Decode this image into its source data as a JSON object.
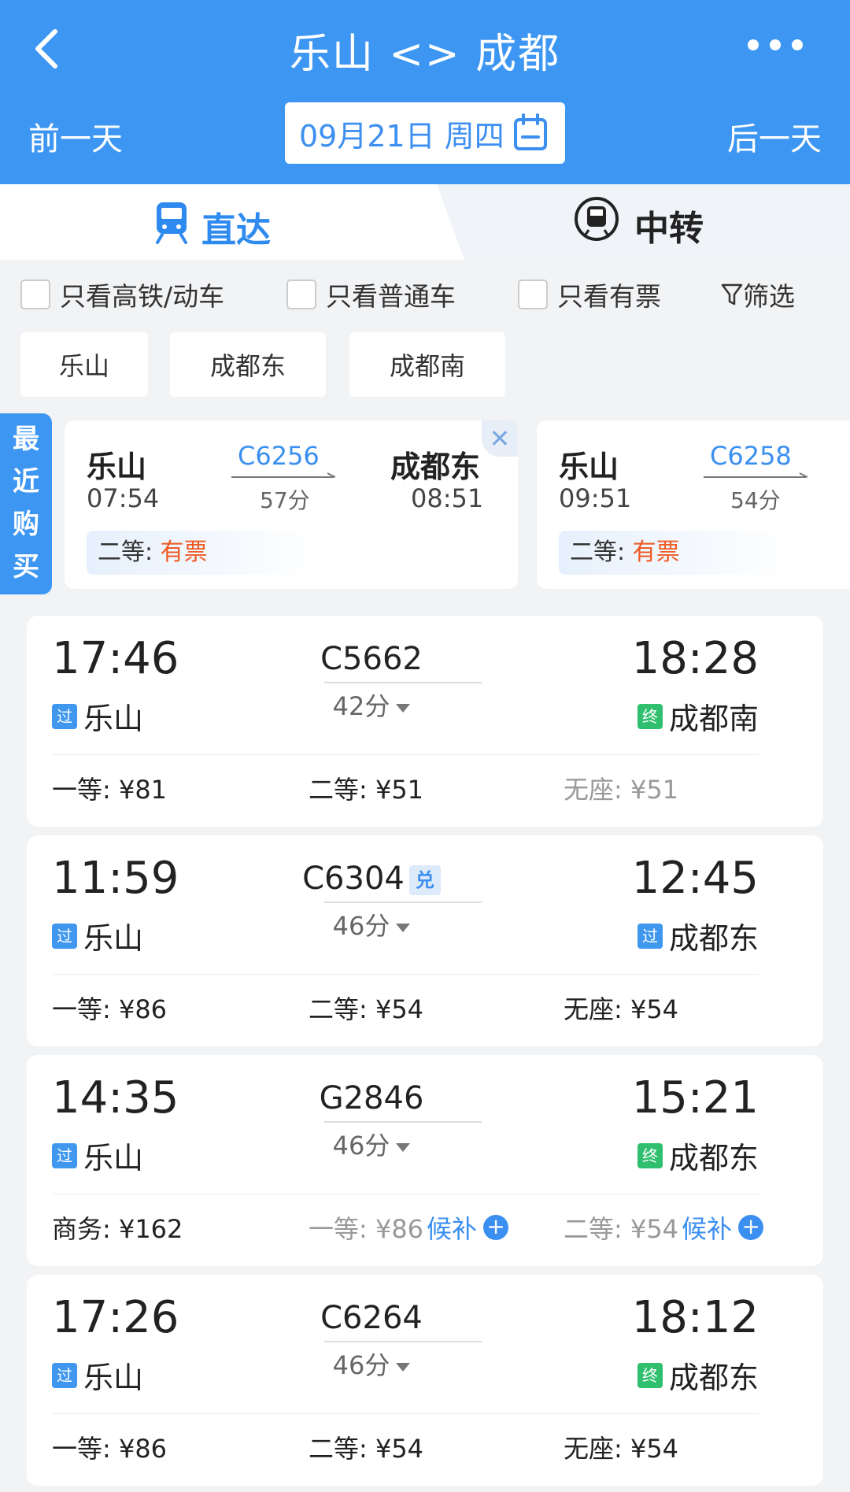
{
  "header": {
    "title": "乐山 <> 成都",
    "prev_day": "前一天",
    "next_day": "后一天",
    "date": "09月21日 周四"
  },
  "tabs": [
    {
      "label": "直达",
      "icon": "train-icon",
      "active": true
    },
    {
      "label": "中转",
      "icon": "transfer-train-icon",
      "active": false
    }
  ],
  "filters": {
    "checkboxes": [
      "只看高铁/动车",
      "只看普通车",
      "只看有票"
    ],
    "filter_label": "筛选",
    "stations": [
      "乐山",
      "成都东",
      "成都南"
    ]
  },
  "recent": {
    "tag": "最近购买",
    "cards": [
      {
        "from": "乐山",
        "dep": "07:54",
        "train": "C6256",
        "duration": "57分",
        "to": "成都东",
        "arr": "08:51",
        "seat": "二等:",
        "status": "有票"
      },
      {
        "from": "乐山",
        "dep": "09:51",
        "train": "C6258",
        "duration": "54分",
        "seat": "二等:",
        "status": "有票"
      }
    ]
  },
  "trains": [
    {
      "dep": "17:46",
      "from": "乐山",
      "from_badge": "过",
      "train": "C5662",
      "duration": "42分",
      "arr": "18:28",
      "to": "成都南",
      "to_badge": "终",
      "prices": [
        {
          "text": "一等: ¥81",
          "gray": false
        },
        {
          "text": "二等: ¥51",
          "gray": false
        },
        {
          "text": "无座: ¥51",
          "gray": true
        }
      ]
    },
    {
      "dep": "11:59",
      "from": "乐山",
      "from_badge": "过",
      "train": "C6304",
      "tag": "兑",
      "duration": "46分",
      "arr": "12:45",
      "to": "成都东",
      "to_badge": "过",
      "prices": [
        {
          "text": "一等: ¥86",
          "gray": false
        },
        {
          "text": "二等: ¥54",
          "gray": false
        },
        {
          "text": "无座: ¥54",
          "gray": false
        }
      ]
    },
    {
      "dep": "14:35",
      "from": "乐山",
      "from_badge": "过",
      "train": "G2846",
      "duration": "46分",
      "arr": "15:21",
      "to": "成都东",
      "to_badge": "终",
      "prices": [
        {
          "text": "商务: ¥162",
          "gray": false
        },
        {
          "text": "一等: ¥86",
          "gray": true,
          "waitlist": "候补"
        },
        {
          "text": "二等: ¥54",
          "gray": true,
          "waitlist": "候补"
        }
      ]
    },
    {
      "dep": "17:26",
      "from": "乐山",
      "from_badge": "过",
      "train": "C6264",
      "duration": "46分",
      "arr": "18:12",
      "to": "成都东",
      "to_badge": "终",
      "prices": [
        {
          "text": "一等: ¥86",
          "gray": false
        },
        {
          "text": "二等: ¥54",
          "gray": false
        },
        {
          "text": "无座: ¥54",
          "gray": false
        }
      ]
    }
  ],
  "colors": {
    "primary": "#3d97f2",
    "accent_orange": "#ee5a24",
    "end_badge": "#2fbf6e"
  }
}
